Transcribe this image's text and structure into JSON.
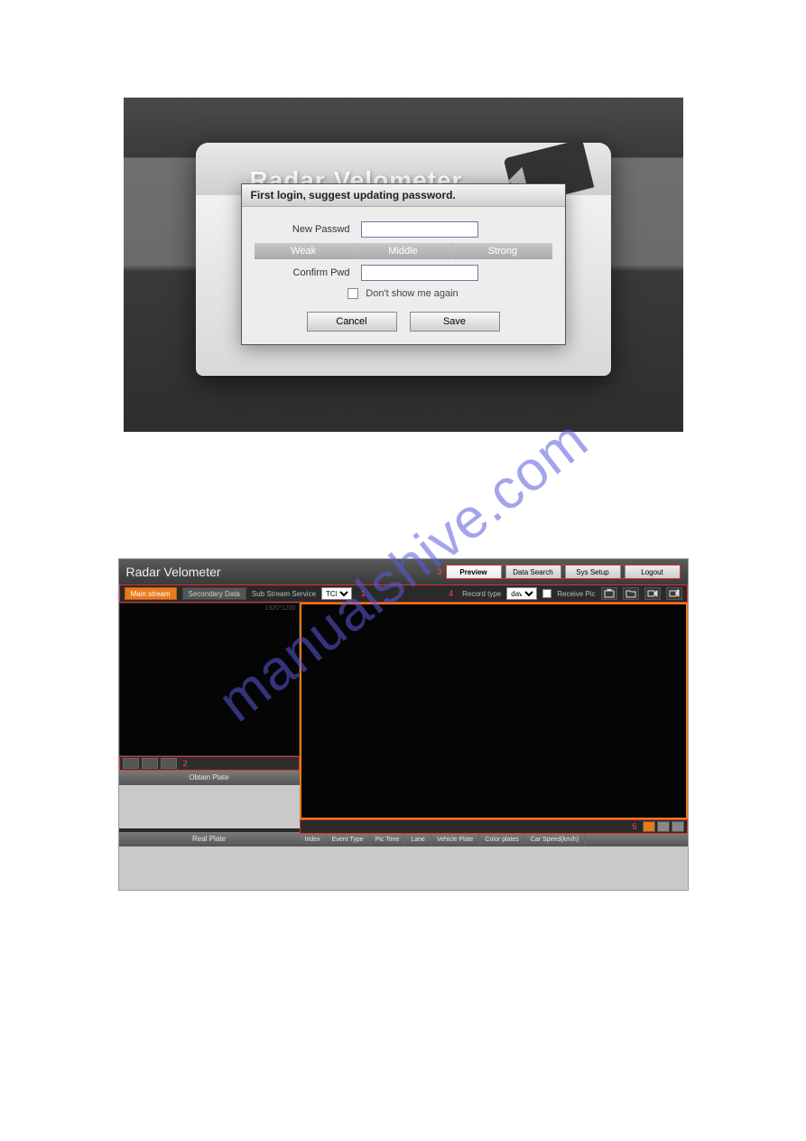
{
  "login": {
    "brand": "Radar Velometer",
    "modal_title": "First login, suggest updating password.",
    "new_pwd_label": "New Passwd",
    "new_pwd_value": "",
    "strength": {
      "weak": "Weak",
      "middle": "Middle",
      "strong": "Strong"
    },
    "confirm_label": "Confirm Pwd",
    "confirm_value": "",
    "dont_show": "Don't show me again",
    "cancel": "Cancel",
    "save": "Save"
  },
  "preview": {
    "title": "Radar Velometer",
    "marks": {
      "m1": "1",
      "m2": "2",
      "m3": "3",
      "m4": "4",
      "m5": "5"
    },
    "tabs": {
      "preview": "Preview",
      "data_search": "Data Search",
      "sys_setup": "Sys Setup",
      "logout": "Logout"
    },
    "toolbar": {
      "main_stream": "Main stream",
      "secondary": "Secondary Data",
      "sub_label": "Sub Stream Service",
      "sub_value": "TCP",
      "record_label": "Record type",
      "record_value": "dav",
      "receive_pic": "Receive Pic"
    },
    "thumb": {
      "bitrate": "",
      "resolution": "1920*1200"
    },
    "left_sections": {
      "obtain": "Obtain Plate",
      "real": "Real Plate"
    },
    "table_headers": [
      "Index",
      "Event Type",
      "Pic Time",
      "Lane",
      "Vehicle Plate",
      "Color plates",
      "Car Speed(km/h)"
    ]
  },
  "watermark": "manualshive.com"
}
